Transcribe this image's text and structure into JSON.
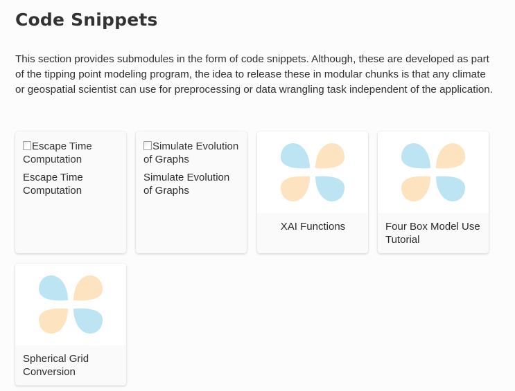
{
  "header": {
    "title": "Code Snippets",
    "description": "This section provides submodules in the form of code snippets. Although, these are developed as part of the tipping point modeling program, the idea to release these in modular chunks is that any climate or geospatial scientist can use for preprocessing or data wrangling task independent of the application."
  },
  "colors": {
    "petal_blue": "#bde4f2",
    "petal_orange": "#fde3bf"
  },
  "cards": [
    {
      "alt": "Escape Time Computation",
      "title": "Escape Time Computation",
      "icon": "broken-image-icon"
    },
    {
      "alt": "Simulate Evolution of Graphs",
      "title": "Simulate Evolution of Graphs",
      "icon": "broken-image-icon"
    },
    {
      "title": "XAI Functions",
      "icon": "clover-logo-icon"
    },
    {
      "title": "Four Box Model Use Tutorial",
      "icon": "clover-logo-icon"
    },
    {
      "title": "Spherical Grid Conversion",
      "icon": "clover-logo-icon"
    }
  ]
}
